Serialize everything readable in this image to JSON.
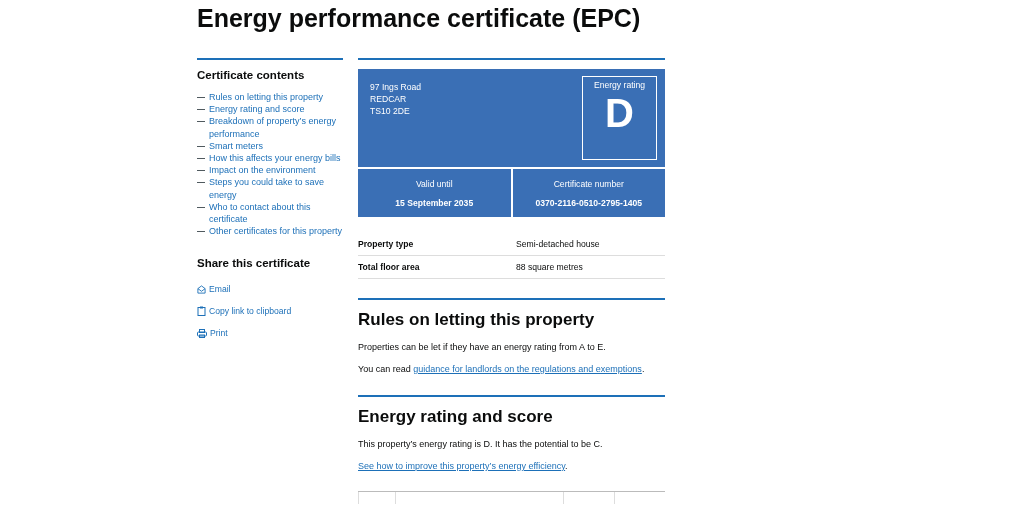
{
  "title": "Energy performance certificate (EPC)",
  "sidebar": {
    "contents_heading": "Certificate contents",
    "contents": [
      "Rules on letting this property",
      "Energy rating and score",
      "Breakdown of property’s energy performance",
      "Smart meters",
      "How this affects your energy bills",
      "Impact on the environment",
      "Steps you could take to save energy",
      "Who to contact about this certificate",
      "Other certificates for this property"
    ],
    "share_heading": "Share this certificate",
    "share": [
      {
        "kind": "email",
        "label": "Email"
      },
      {
        "kind": "clipboard",
        "label": "Copy link to clipboard"
      },
      {
        "kind": "print",
        "label": "Print"
      }
    ]
  },
  "certificate": {
    "address": [
      "97 Ings Road",
      "REDCAR",
      "TS10 2DE"
    ],
    "rating_label": "Energy rating",
    "rating": "D",
    "valid_label": "Valid until",
    "valid": "15 September 2035",
    "number_label": "Certificate number",
    "number": "0370-2116-0510-2795-1405"
  },
  "summary": [
    {
      "label": "Property type",
      "value": "Semi-detached house"
    },
    {
      "label": "Total floor area",
      "value": "88 square metres"
    }
  ],
  "sections": [
    {
      "heading": "Rules on letting this property",
      "text": "Properties can be let if they have an energy rating from A to E.",
      "link_before": "You can read ",
      "link": "guidance for landlords on the regulations and exemptions",
      "link_after": "."
    },
    {
      "heading": "Energy rating and score",
      "text": "This property’s energy rating is D. It has the potential to be C.",
      "link": "See how to improve this property’s energy efficiency",
      "link_after": "."
    }
  ]
}
